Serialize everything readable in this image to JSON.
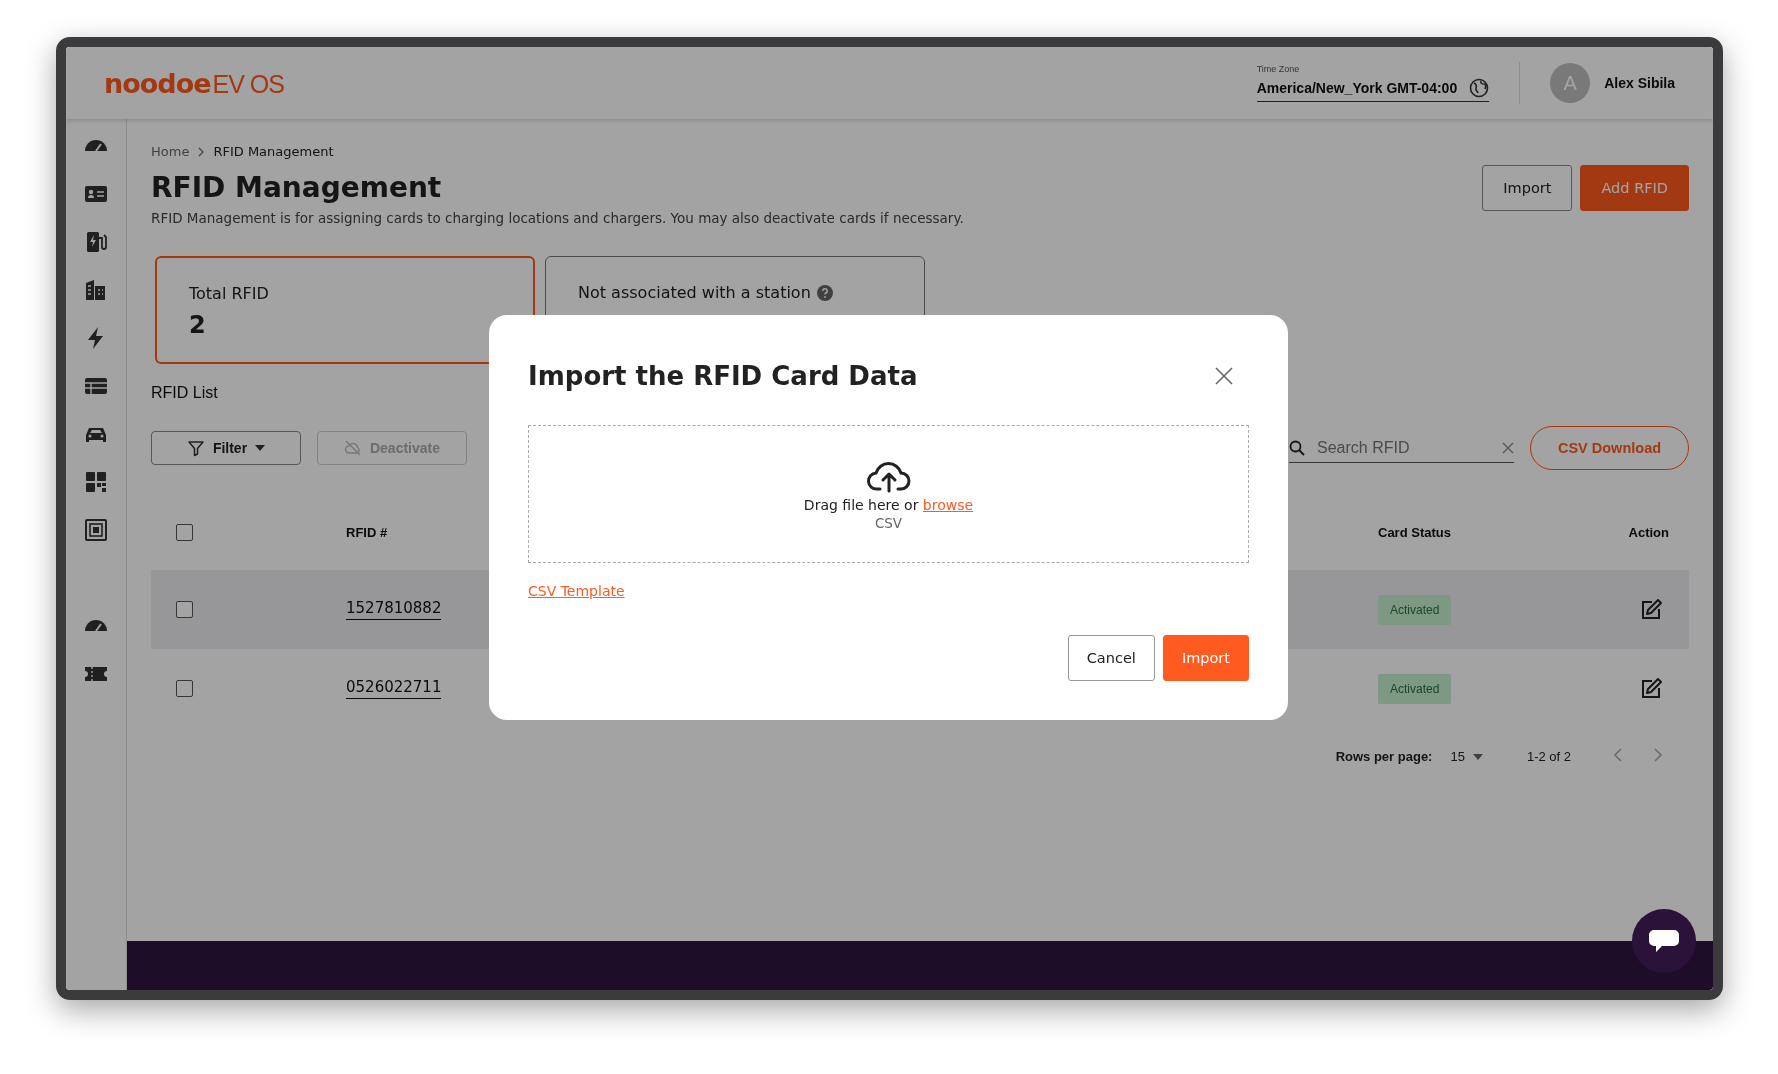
{
  "header": {
    "logo_main": "noodoe",
    "logo_sub": "EV OS",
    "timezone": {
      "label": "Time Zone",
      "value": "America/New_York GMT-04:00"
    },
    "user": {
      "initial": "A",
      "name": "Alex Sibila"
    }
  },
  "breadcrumb": [
    "Home",
    "RFID Management"
  ],
  "page": {
    "title": "RFID Management",
    "description": "RFID Management is for assigning cards to charging locations and chargers. You may also deactivate cards if necessary."
  },
  "actions": [
    {
      "label": "Import",
      "kind": "outline"
    },
    {
      "label": "Add RFID",
      "kind": "primary"
    }
  ],
  "stats": [
    {
      "label": "Total RFID",
      "value": "2",
      "selected": true,
      "has_help": false
    },
    {
      "label": "Not associated with a station",
      "selected": false,
      "has_help": true
    }
  ],
  "list": {
    "title": "RFID List",
    "filter": "Filter",
    "deactivate": {
      "label": "Deactivate",
      "disabled": true
    },
    "search": {
      "placeholder": "Search RFID"
    },
    "download": "CSV Download"
  },
  "table": {
    "header_checked": false,
    "columns": [
      {
        "label": "RFID #"
      },
      {
        "label": "Card Status"
      },
      {
        "label": "Action"
      }
    ],
    "rows": [
      {
        "rfid": "1527810882",
        "status": "Activated",
        "checked": false,
        "highlighted": true
      },
      {
        "rfid": "0526022711",
        "status": "Activated",
        "checked": false,
        "highlighted": false
      }
    ]
  },
  "pagination": {
    "label": "Rows per page:",
    "value": "15",
    "range": "1-2 of 2"
  },
  "modal": {
    "title": "Import the RFID Card Data",
    "drop_text": "Drag file here or ",
    "browse": "browse",
    "file_type": "CSV",
    "template_link": "CSV Template",
    "buttons": [
      {
        "label": "Cancel",
        "kind": "secondary"
      },
      {
        "label": "Import",
        "kind": "primary"
      }
    ]
  }
}
